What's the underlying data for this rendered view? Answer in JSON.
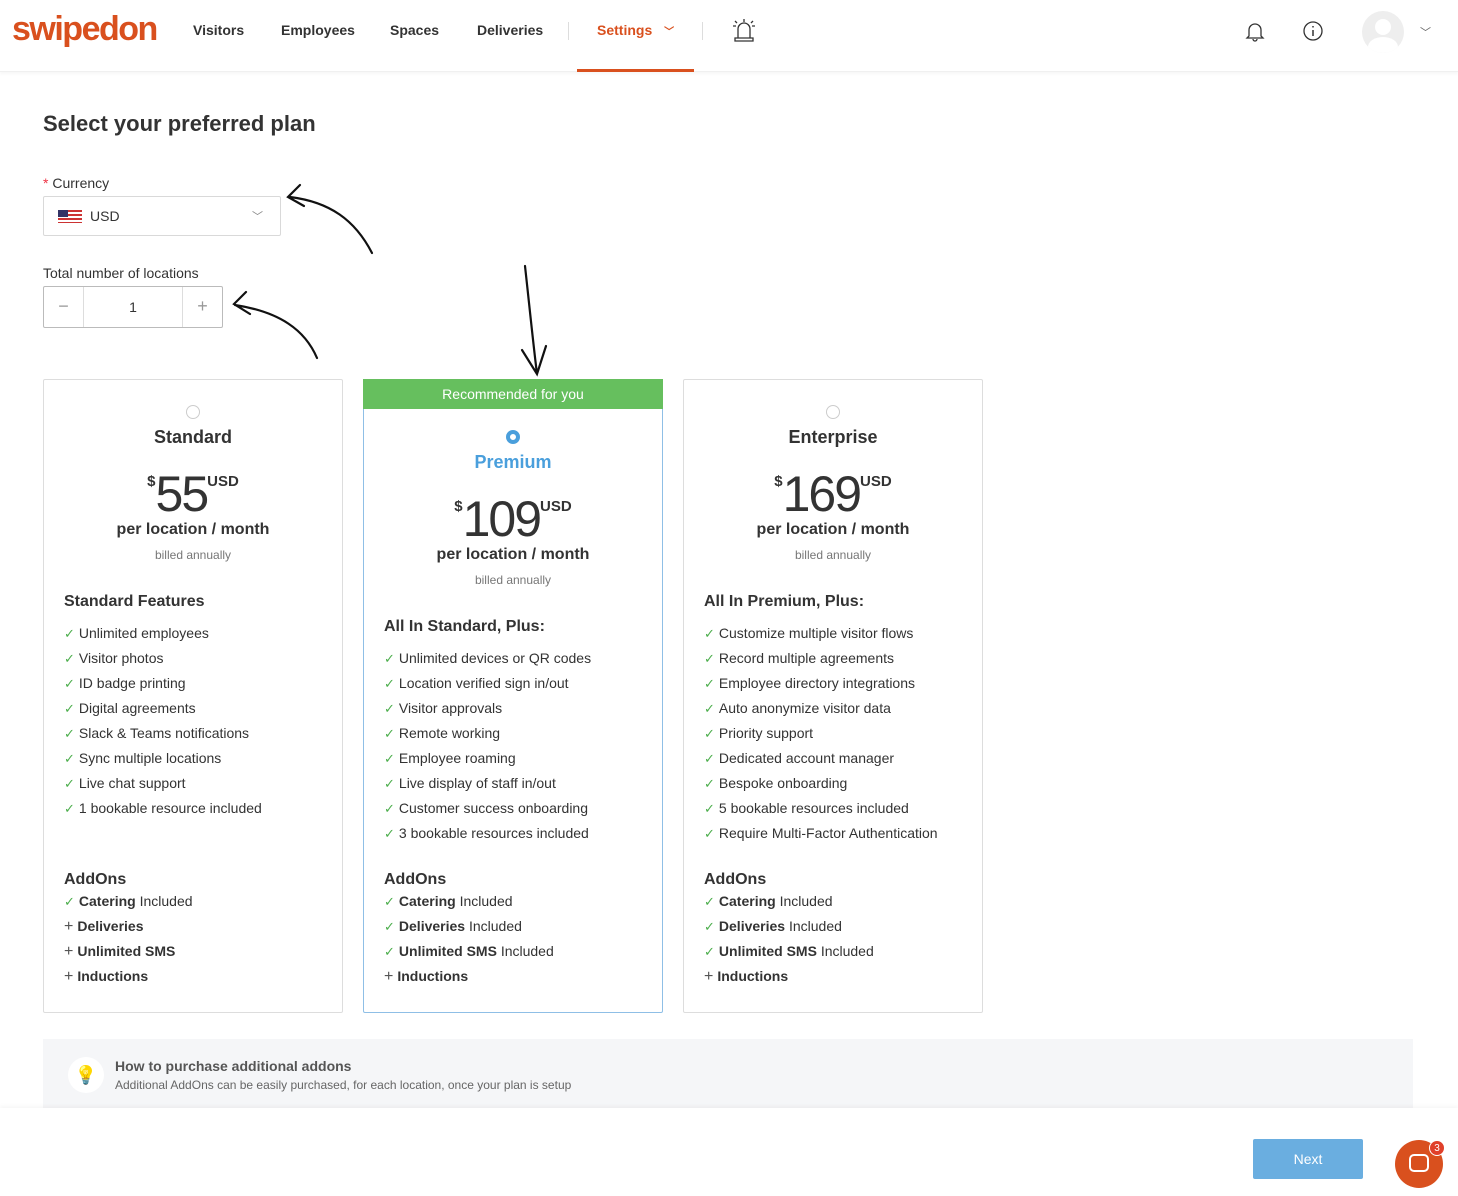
{
  "nav": {
    "logo": "swipedon",
    "items": [
      "Visitors",
      "Employees",
      "Spaces",
      "Deliveries"
    ],
    "settings": "Settings",
    "accent": "#d9501e"
  },
  "page": {
    "title": "Select your preferred plan",
    "currency_label": "Currency",
    "currency_value": "USD",
    "locations_label": "Total number of locations",
    "locations_value": "1"
  },
  "plans": [
    {
      "name": "Standard",
      "currency_symbol": "$",
      "price": "55",
      "currency": "USD",
      "per": "per location / month",
      "billed": "billed annually",
      "selected": false,
      "features_title": "Standard Features",
      "features": [
        "Unlimited employees",
        "Visitor photos",
        "ID badge printing",
        "Digital agreements",
        "Slack & Teams notifications",
        "Sync multiple locations",
        "Live chat support",
        "1 bookable resource included"
      ],
      "addons_title": "AddOns",
      "addons": [
        {
          "name": "Catering",
          "suffix": "Included",
          "icon": "check"
        },
        {
          "name": "Deliveries",
          "suffix": "",
          "icon": "plus"
        },
        {
          "name": "Unlimited SMS",
          "suffix": "",
          "icon": "plus"
        },
        {
          "name": "Inductions",
          "suffix": "",
          "icon": "plus"
        }
      ]
    },
    {
      "name": "Premium",
      "badge": "Recommended for you",
      "currency_symbol": "$",
      "price": "109",
      "currency": "USD",
      "per": "per location / month",
      "billed": "billed annually",
      "selected": true,
      "features_title": "All In Standard, Plus:",
      "features": [
        "Unlimited devices or QR codes",
        "Location verified sign in/out",
        "Visitor approvals",
        "Remote working",
        "Employee roaming",
        "Live display of staff in/out",
        "Customer success onboarding",
        "3 bookable resources included"
      ],
      "addons_title": "AddOns",
      "addons": [
        {
          "name": "Catering",
          "suffix": "Included",
          "icon": "check"
        },
        {
          "name": "Deliveries",
          "suffix": "Included",
          "icon": "check"
        },
        {
          "name": "Unlimited SMS",
          "suffix": "Included",
          "icon": "check"
        },
        {
          "name": "Inductions",
          "suffix": "",
          "icon": "plus"
        }
      ]
    },
    {
      "name": "Enterprise",
      "currency_symbol": "$",
      "price": "169",
      "currency": "USD",
      "per": "per location / month",
      "billed": "billed annually",
      "selected": false,
      "features_title": "All In Premium, Plus:",
      "features": [
        "Customize multiple visitor flows",
        "Record multiple agreements",
        "Employee directory integrations",
        "Auto anonymize visitor data",
        "Priority support",
        "Dedicated account manager",
        "Bespoke onboarding",
        "5 bookable resources included",
        "Require Multi-Factor Authentication"
      ],
      "addons_title": "AddOns",
      "addons": [
        {
          "name": "Catering",
          "suffix": "Included",
          "icon": "check"
        },
        {
          "name": "Deliveries",
          "suffix": "Included",
          "icon": "check"
        },
        {
          "name": "Unlimited SMS",
          "suffix": "Included",
          "icon": "check"
        },
        {
          "name": "Inductions",
          "suffix": "",
          "icon": "plus"
        }
      ]
    }
  ],
  "info": {
    "title": "How to purchase additional addons",
    "text": "Additional AddOns can be easily purchased, for each location, once your plan is setup"
  },
  "footer": {
    "next": "Next",
    "chat_badge": "3"
  }
}
